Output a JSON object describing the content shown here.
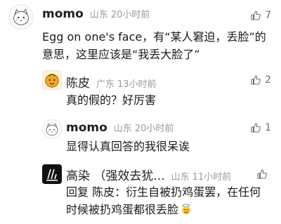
{
  "comments": [
    {
      "author": "momo",
      "location": "山东",
      "time": "20小时前",
      "likes": "7",
      "text_lines": [
        "Egg on one's face，有“某人窘迫，丢脸”的",
        "意思，这里应该是“我丢大脸了”"
      ]
    },
    {
      "author": "陈皮",
      "location": "广东",
      "time": "13小时前",
      "likes": "2",
      "text_lines": [
        "真的假的？好厉害"
      ]
    },
    {
      "author": "momo",
      "location": "山东",
      "time": "20小时前",
      "likes": "1",
      "text_lines": [
        "显得认真回答的我很呆诶"
      ]
    },
    {
      "author": "高染 （强效去犹...",
      "location": "山东",
      "time": "11小时前",
      "likes": "",
      "reply_prefix": "回复",
      "reply_target": "陈皮",
      "text_lines": [
        "：衍生自被扔鸡蛋罢，在任何",
        "时候被扔鸡蛋都很丢脸"
      ]
    }
  ],
  "icons": {
    "like": "thumbs-up-icon",
    "emoji": "smiling-face-with-halo-emoji"
  },
  "colors": {
    "text": "#1a1a1a",
    "meta": "#9a9a9a",
    "like": "#6f6f6f"
  }
}
